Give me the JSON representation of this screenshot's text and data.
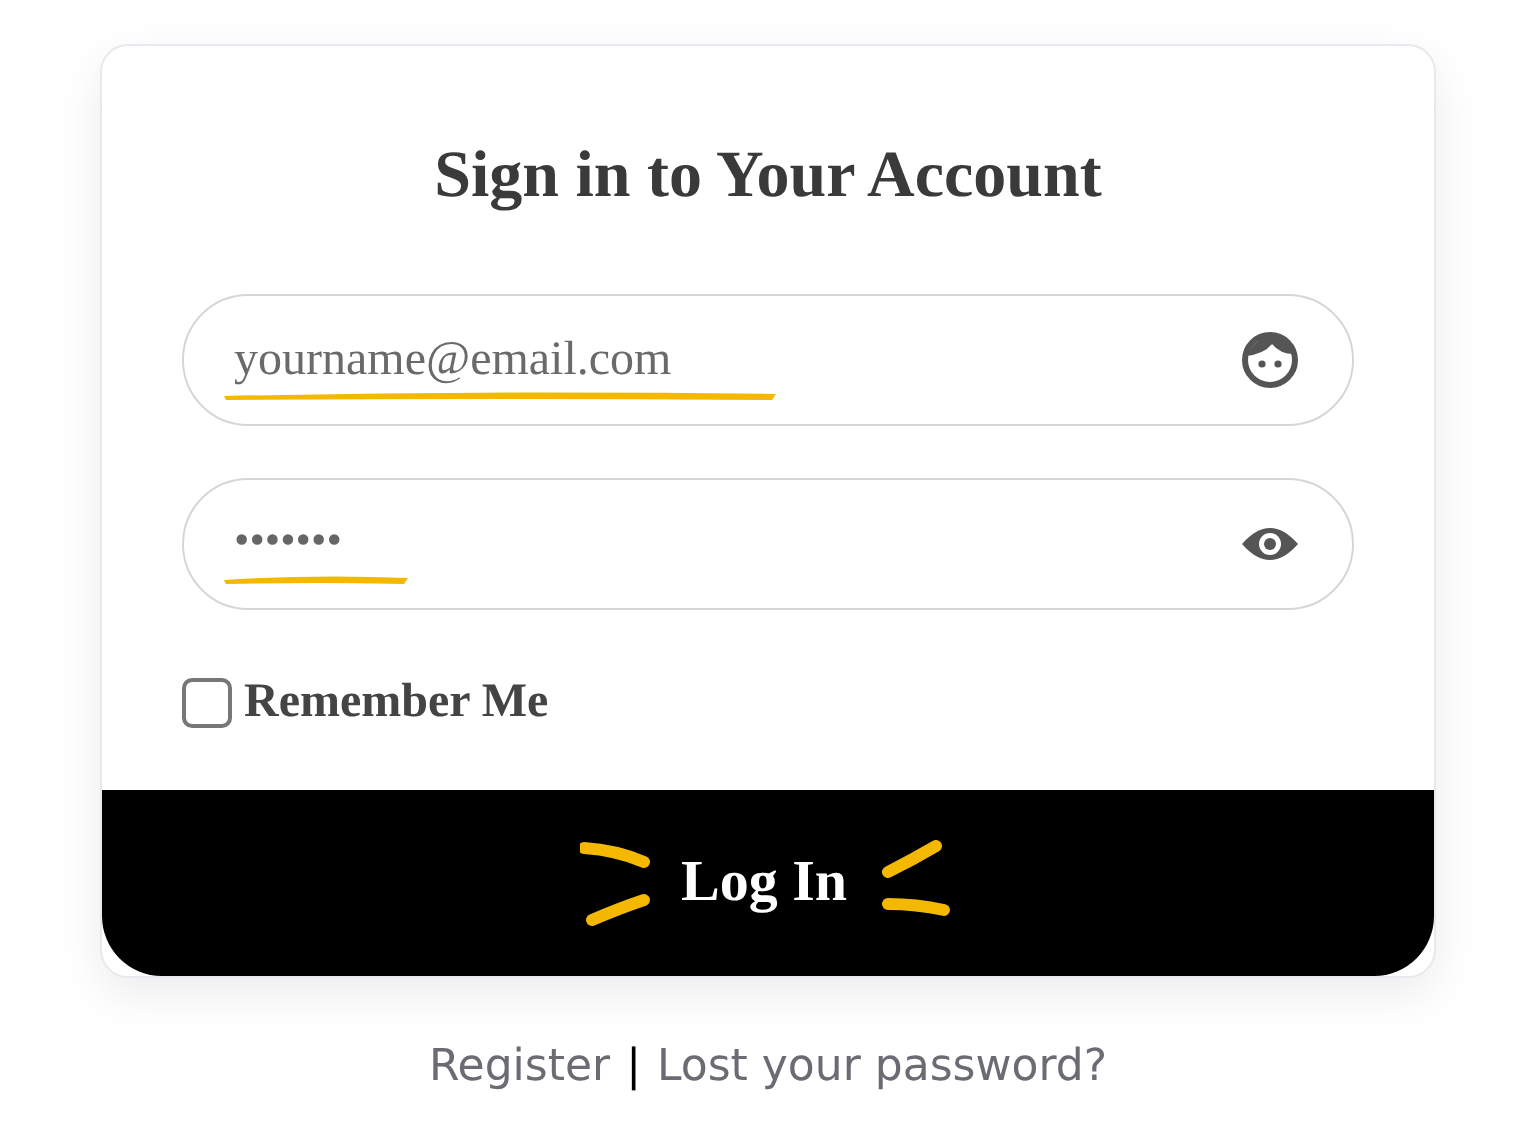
{
  "title": "Sign in to Your Account",
  "email_field": {
    "placeholder": "yourname@email.com"
  },
  "password_field": {
    "value": "•••••••"
  },
  "remember_me": {
    "label": "Remember Me",
    "checked": false
  },
  "login_button": {
    "label": "Log In"
  },
  "links": [
    "Register",
    "Lost your password?"
  ],
  "link_separator": "|"
}
